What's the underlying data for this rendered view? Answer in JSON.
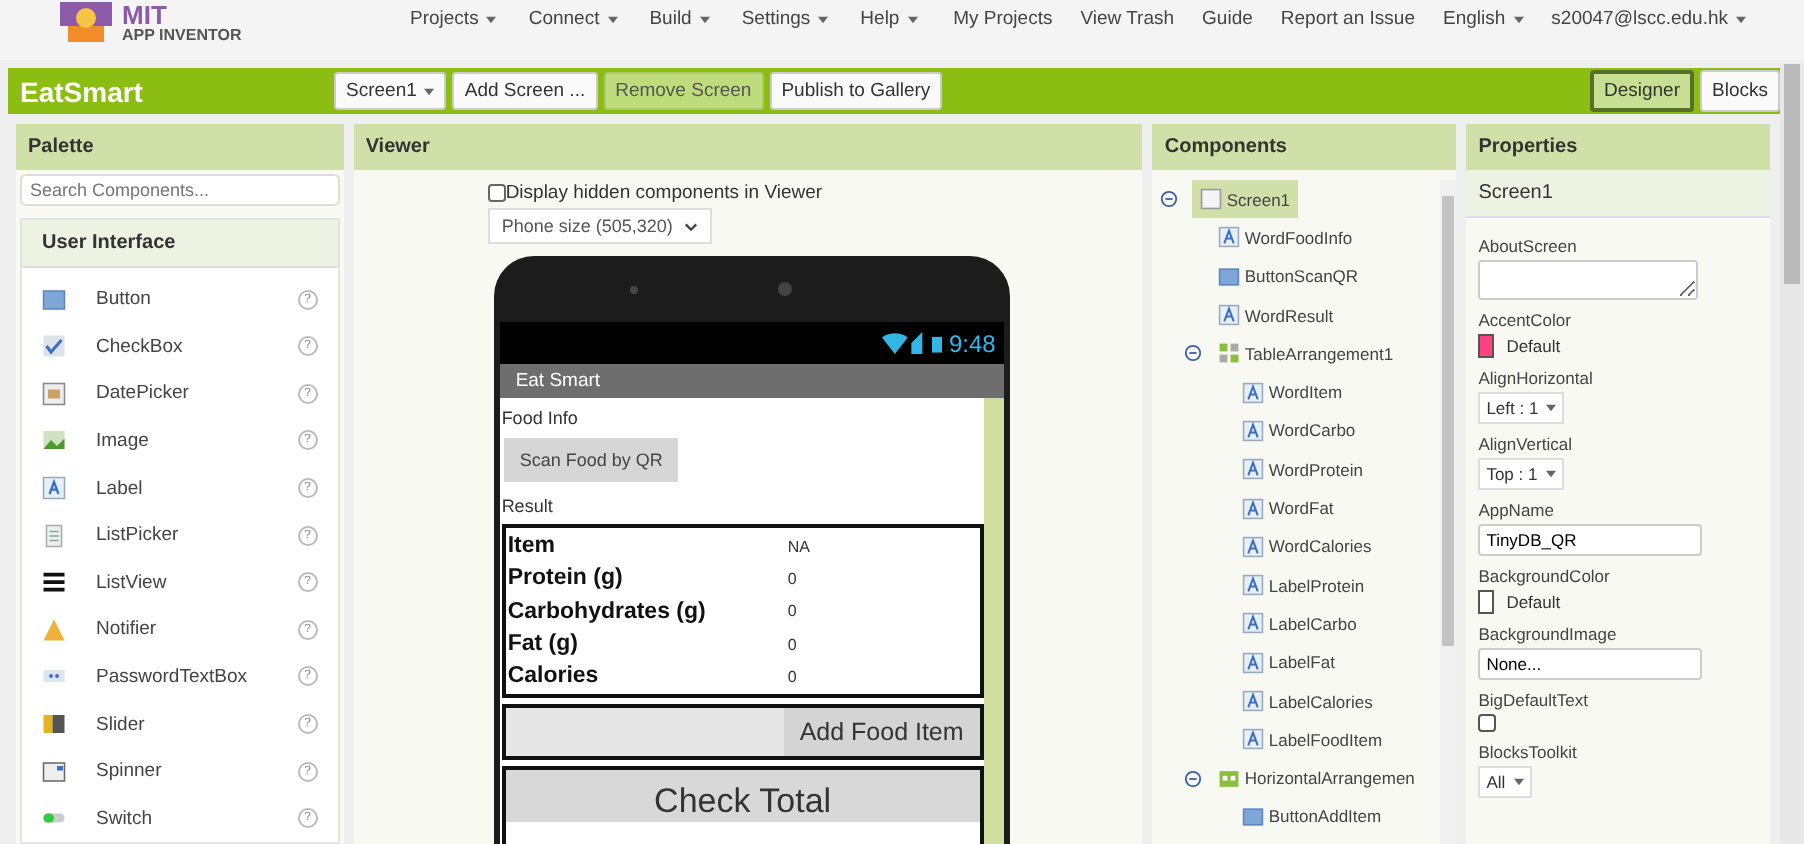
{
  "logo": {
    "title": "MIT",
    "subtitle": "APP INVENTOR"
  },
  "top_menu": [
    {
      "label": "Projects",
      "dropdown": true
    },
    {
      "label": "Connect",
      "dropdown": true
    },
    {
      "label": "Build",
      "dropdown": true
    },
    {
      "label": "Settings",
      "dropdown": true
    },
    {
      "label": "Help",
      "dropdown": true
    }
  ],
  "top_links": [
    {
      "label": "My Projects",
      "dropdown": false
    },
    {
      "label": "View Trash",
      "dropdown": false
    },
    {
      "label": "Guide",
      "dropdown": false
    },
    {
      "label": "Report an Issue",
      "dropdown": false
    },
    {
      "label": "English",
      "dropdown": true
    },
    {
      "label": "s20047@lscc.edu.hk",
      "dropdown": true
    }
  ],
  "project": {
    "name": "EatSmart",
    "buttons": [
      {
        "label": "Screen1",
        "dropdown": true,
        "disabled": false
      },
      {
        "label": "Add Screen ...",
        "dropdown": false,
        "disabled": false
      },
      {
        "label": "Remove Screen",
        "dropdown": false,
        "disabled": true
      },
      {
        "label": "Publish to Gallery",
        "dropdown": false,
        "disabled": false
      }
    ],
    "views": [
      {
        "label": "Designer",
        "selected": true
      },
      {
        "label": "Blocks",
        "selected": false
      }
    ]
  },
  "palette": {
    "title": "Palette",
    "search": {
      "placeholder": "Search Components..."
    },
    "category": "User Interface",
    "items": [
      {
        "label": "Button",
        "kind": "button",
        "help": "?"
      },
      {
        "label": "CheckBox",
        "kind": "checkbox",
        "help": "?"
      },
      {
        "label": "DatePicker",
        "kind": "datepicker",
        "help": "?"
      },
      {
        "label": "Image",
        "kind": "image",
        "help": "?"
      },
      {
        "label": "Label",
        "kind": "label",
        "help": "?"
      },
      {
        "label": "ListPicker",
        "kind": "listpicker",
        "help": "?"
      },
      {
        "label": "ListView",
        "kind": "listview",
        "help": "?"
      },
      {
        "label": "Notifier",
        "kind": "notifier",
        "help": "?"
      },
      {
        "label": "PasswordTextBox",
        "kind": "password",
        "help": "?"
      },
      {
        "label": "Slider",
        "kind": "slider",
        "help": "?"
      },
      {
        "label": "Spinner",
        "kind": "spinner",
        "help": "?"
      },
      {
        "label": "Switch",
        "kind": "switch",
        "help": "?"
      }
    ]
  },
  "viewer": {
    "title": "Viewer",
    "hidden_toggle": {
      "label": "Display hidden components in Viewer",
      "checked": false
    },
    "size_select": "Phone size (505,320)",
    "phone": {
      "time": "9:48",
      "app_title": "Eat Smart",
      "food_info": "Food Info",
      "scan_button": "Scan Food by QR",
      "result": "Result",
      "table": [
        {
          "label": "Item",
          "value": "NA"
        },
        {
          "label": "Protein (g)",
          "value": "0"
        },
        {
          "label": "Carbohydrates (g)",
          "value": "0"
        },
        {
          "label": "Fat (g)",
          "value": "0"
        },
        {
          "label": "Calories",
          "value": "0"
        }
      ],
      "add_button": "Add Food Item",
      "total_button": "Check Total"
    }
  },
  "components": {
    "title": "Components",
    "tree": [
      {
        "label": "Screen1",
        "kind": "screen",
        "selected": true,
        "expanded": true,
        "children": [
          {
            "label": "WordFoodInfo",
            "kind": "label",
            "selected": false
          },
          {
            "label": "ButtonScanQR",
            "kind": "button",
            "selected": false
          },
          {
            "label": "WordResult",
            "kind": "label",
            "selected": false
          },
          {
            "label": "TableArrangement1",
            "kind": "table",
            "selected": false,
            "expanded": true,
            "children": [
              {
                "label": "WordItem",
                "kind": "label",
                "selected": false
              },
              {
                "label": "WordCarbo",
                "kind": "label",
                "selected": false
              },
              {
                "label": "WordProtein",
                "kind": "label",
                "selected": false
              },
              {
                "label": "WordFat",
                "kind": "label",
                "selected": false
              },
              {
                "label": "WordCalories",
                "kind": "label",
                "selected": false
              },
              {
                "label": "LabelProtein",
                "kind": "label",
                "selected": false
              },
              {
                "label": "LabelCarbo",
                "kind": "label",
                "selected": false
              },
              {
                "label": "LabelFat",
                "kind": "label",
                "selected": false
              },
              {
                "label": "LabelCalories",
                "kind": "label",
                "selected": false
              },
              {
                "label": "LabelFoodItem",
                "kind": "label",
                "selected": false
              }
            ]
          },
          {
            "label": "HorizontalArrangemen",
            "kind": "horizontal",
            "selected": false,
            "expanded": true,
            "children": [
              {
                "label": "ButtonAddItem",
                "kind": "button",
                "selected": false
              }
            ]
          }
        ]
      }
    ]
  },
  "properties": {
    "title": "Properties",
    "target": "Screen1",
    "items": [
      {
        "label": "AboutScreen",
        "kind": "textarea"
      },
      {
        "label": "AccentColor",
        "kind": "color",
        "value": "Default",
        "color": "#ff4081"
      },
      {
        "label": "AlignHorizontal",
        "kind": "select",
        "value": "Left : 1"
      },
      {
        "label": "AlignVertical",
        "kind": "select",
        "value": "Top : 1"
      },
      {
        "label": "AppName",
        "kind": "text",
        "value": "TinyDB_QR"
      },
      {
        "label": "BackgroundColor",
        "kind": "color",
        "value": "Default",
        "color": "#ffffff"
      },
      {
        "label": "BackgroundImage",
        "kind": "text",
        "value": "None..."
      },
      {
        "label": "BigDefaultText",
        "kind": "checkbox",
        "checked": false
      },
      {
        "label": "BlocksToolkit",
        "kind": "select",
        "value": "All"
      }
    ]
  }
}
